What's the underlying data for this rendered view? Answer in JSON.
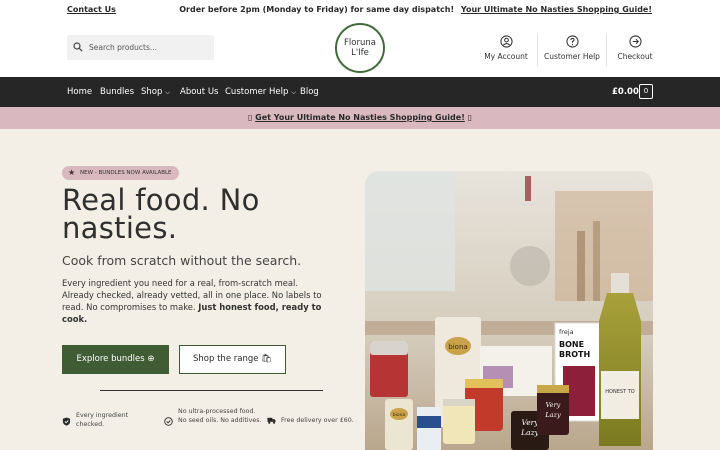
{
  "topbar": {
    "contact": "Contact Us",
    "dispatch": "Order before 2pm (Monday to Friday) for same day dispatch!",
    "guide_link": "Your Ultimate No Nasties Shopping Guide!"
  },
  "header": {
    "search_placeholder": "Search products...",
    "logo_line1": "Floruna",
    "logo_line2": "L'Ife",
    "account": "My Account",
    "help": "Customer Help",
    "checkout": "Checkout"
  },
  "nav": {
    "items": [
      "Home",
      "Bundles",
      "Shop",
      "About Us",
      "Customer Help",
      "Blog"
    ],
    "cart_total": "£0.00",
    "cart_count": "0"
  },
  "banner": {
    "left_glyph": "▯",
    "text": "Get Your Ultimate No Nasties Shopping Guide!",
    "right_glyph": "▯"
  },
  "hero": {
    "badge": "NEW - BUNDLES NOW AVAILABLE",
    "title": "Real food. No nasties.",
    "subtitle": "Cook from scratch without the search.",
    "description": "Every ingredient you need for a real, from-scratch meal. Already checked, already vetted, all in one place. No labels to read. No compromises to make.",
    "description_bold": "Just honest food, ready to cook.",
    "btn_primary": "Explore bundles ⊕",
    "btn_secondary": "Shop the range 🛍"
  },
  "features": [
    {
      "icon": "shield-check-icon",
      "text": "Every ingredient checked."
    },
    {
      "icon": "check-circle-icon",
      "text": "No ultra-processed food. No seed oils. No additives."
    },
    {
      "icon": "truck-icon",
      "text": "Free delivery over £60."
    }
  ],
  "products": {
    "biona_pouch": "biona",
    "biona_jar": "biona",
    "freja_line1": "freja",
    "freja_line2": "BONE",
    "freja_line3": "BROTH",
    "lazy1_line1": "Very",
    "lazy1_line2": "Lazy",
    "lazy2_line1": "Very",
    "lazy2_line2": "Lazy",
    "oil_label": "HONEST TO"
  },
  "colors": {
    "accent_green": "#3f5c34",
    "navbar": "#262626",
    "pink": "#d9b8c0",
    "background": "#f3efe6"
  }
}
